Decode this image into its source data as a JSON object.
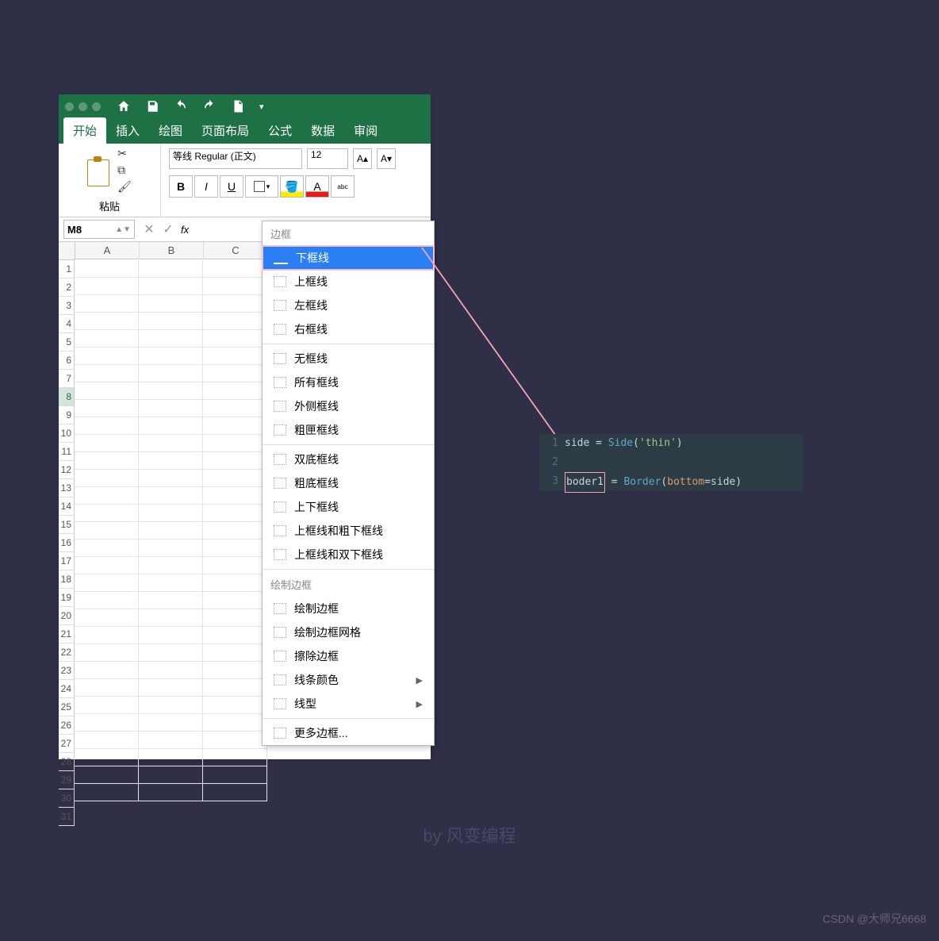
{
  "titlebar": {
    "dots": 3
  },
  "ribbon": {
    "tabs": [
      "开始",
      "插入",
      "绘图",
      "页面布局",
      "公式",
      "数据",
      "审阅"
    ],
    "active_tab": "开始",
    "paste_label": "粘贴",
    "font_name": "等线 Regular (正文)",
    "font_size": "12"
  },
  "namebox": {
    "cell_ref": "M8",
    "fx_label": "fx"
  },
  "grid": {
    "columns": [
      "A",
      "B",
      "C"
    ],
    "row_count": 31,
    "selected_row": 8
  },
  "dropdown": {
    "header": "边框",
    "groups": [
      {
        "items": [
          {
            "label": "下框线",
            "selected": true
          },
          {
            "label": "上框线"
          },
          {
            "label": "左框线"
          },
          {
            "label": "右框线"
          }
        ]
      },
      {
        "items": [
          {
            "label": "无框线"
          },
          {
            "label": "所有框线"
          },
          {
            "label": "外侧框线"
          },
          {
            "label": "粗匣框线"
          }
        ]
      },
      {
        "items": [
          {
            "label": "双底框线"
          },
          {
            "label": "粗底框线"
          },
          {
            "label": "上下框线"
          },
          {
            "label": "上框线和粗下框线"
          },
          {
            "label": "上框线和双下框线"
          }
        ]
      },
      {
        "header": "绘制边框",
        "items": [
          {
            "label": "绘制边框"
          },
          {
            "label": "绘制边框网格"
          },
          {
            "label": "擦除边框"
          },
          {
            "label": "线条颜色",
            "submenu": true
          },
          {
            "label": "线型",
            "submenu": true
          }
        ]
      },
      {
        "items": [
          {
            "label": "更多边框..."
          }
        ]
      }
    ]
  },
  "code": {
    "lines": [
      {
        "n": "1",
        "raw": "side = Side('thin')"
      },
      {
        "n": "2",
        "raw": ""
      },
      {
        "n": "3",
        "raw": "boder1 = Border(bottom=side)"
      }
    ]
  },
  "watermark": "by 风变编程",
  "csdn_mark": "CSDN @大师兄6668"
}
